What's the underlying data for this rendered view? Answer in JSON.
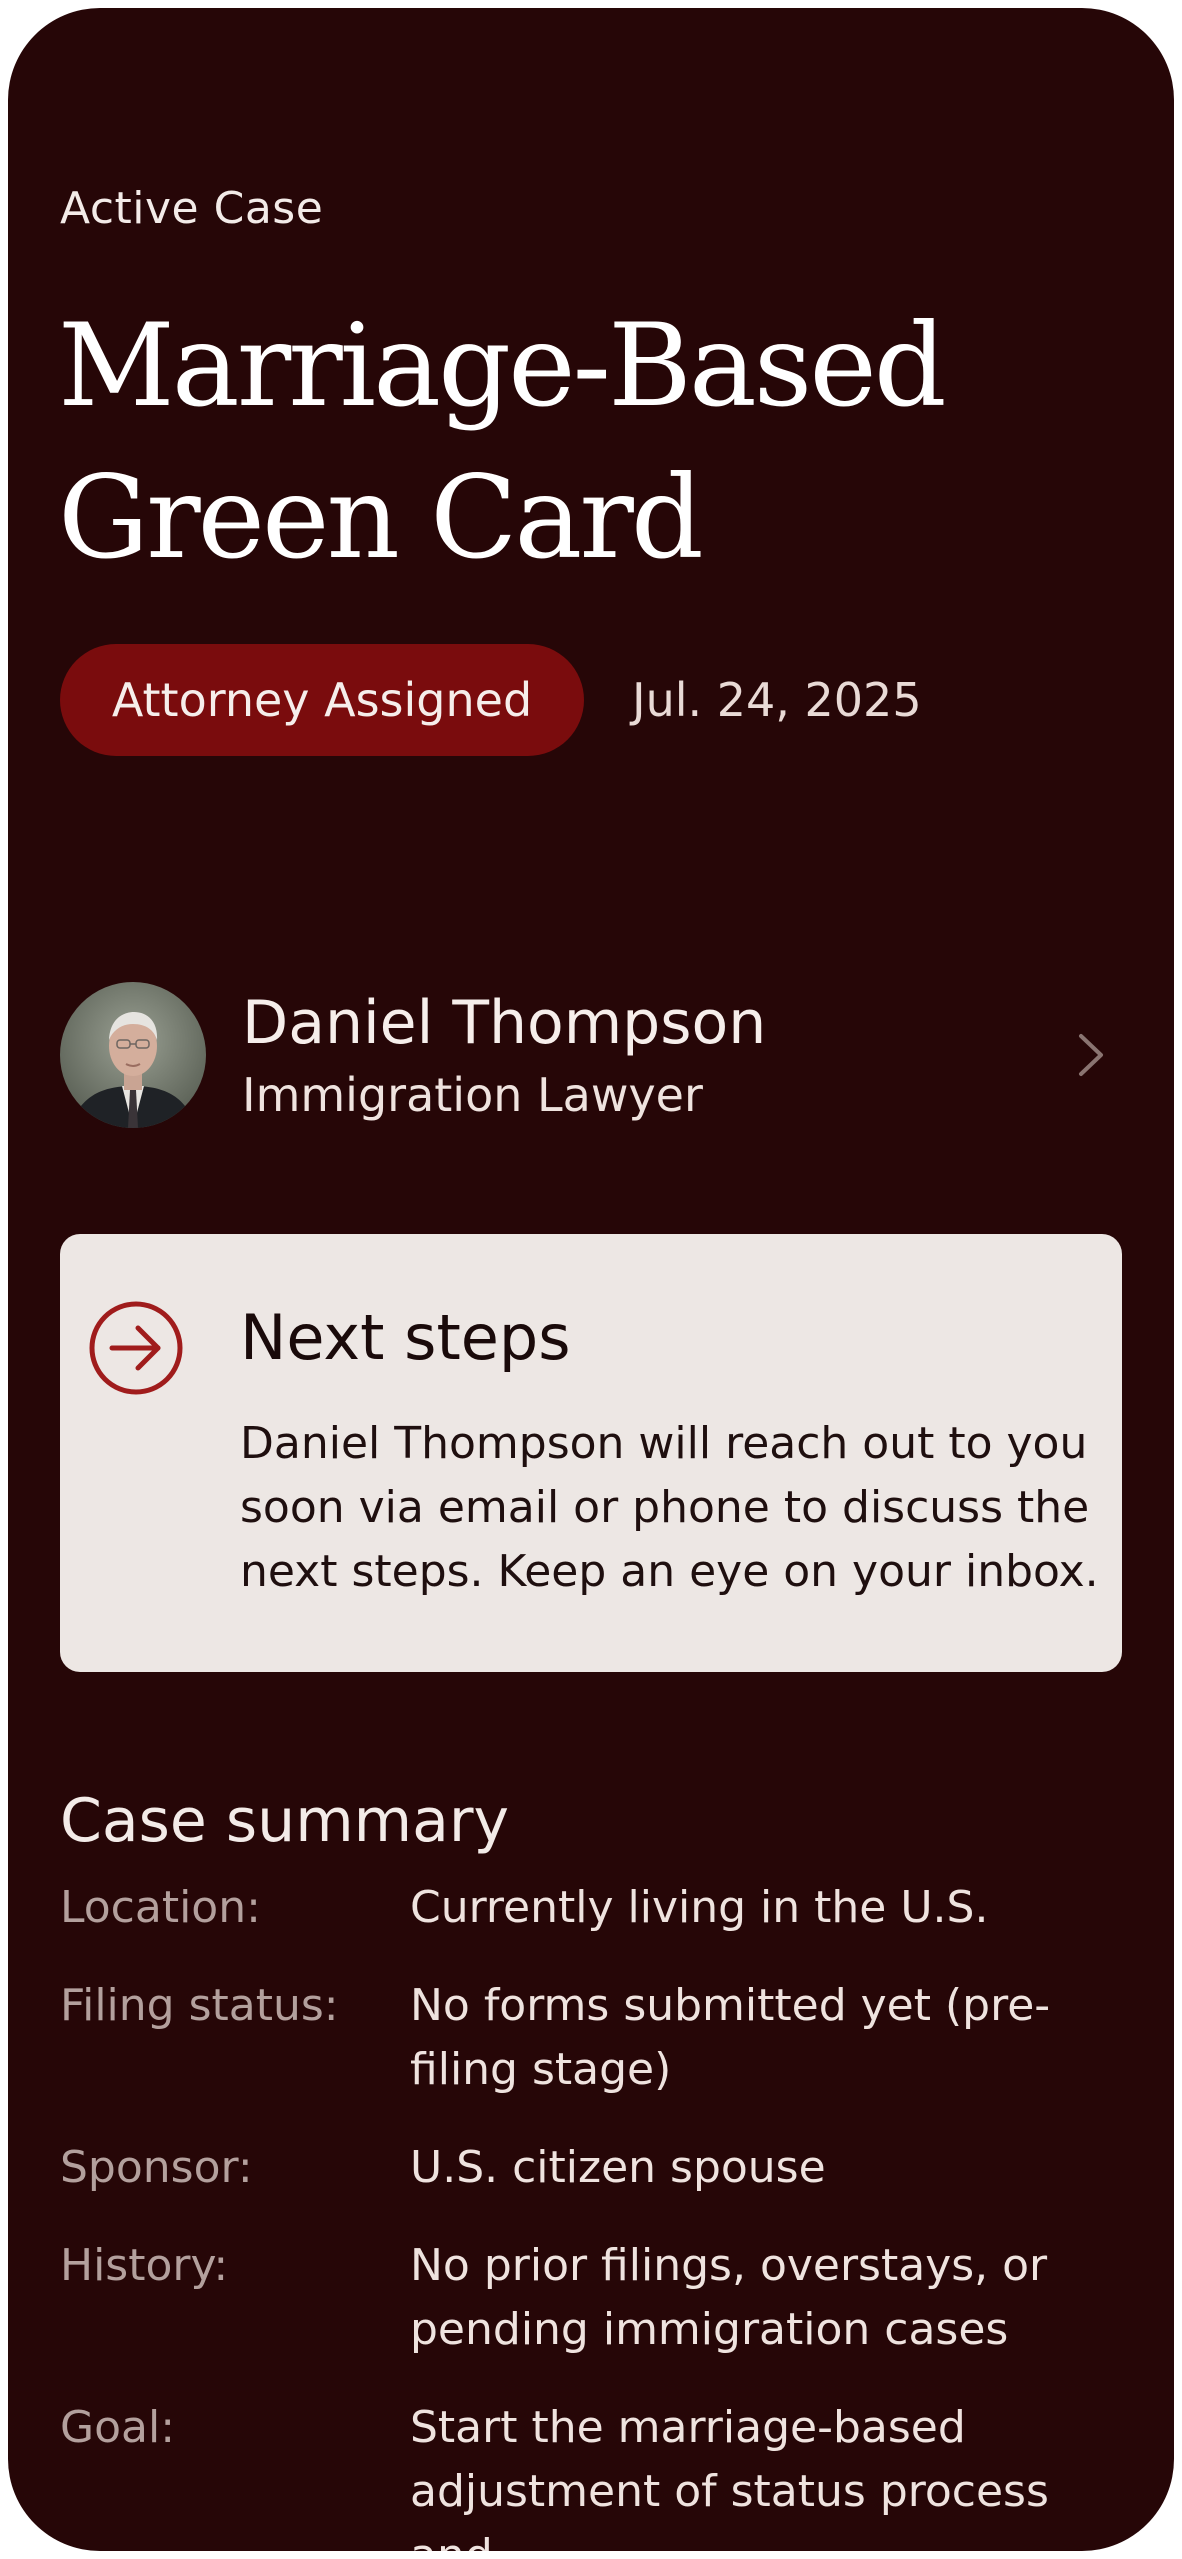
{
  "header": {
    "eyebrow": "Active Case",
    "title": "Marriage-Based Green Card"
  },
  "status": {
    "badge": "Attorney Assigned",
    "date": "Jul. 24, 2025",
    "badge_color": "#7a0c0d"
  },
  "lawyer": {
    "name": "Daniel Thompson",
    "role": "Immigration Lawyer",
    "avatar_icon": "avatar-photo",
    "chevron_icon": "chevron-right-icon"
  },
  "next_steps": {
    "icon": "arrow-right-circle-icon",
    "title": "Next steps",
    "body": "Daniel Thompson will reach out to you soon via email or phone to discuss the next steps. Keep an eye on your inbox."
  },
  "summary": {
    "title": "Case summary",
    "items": [
      {
        "label": "Location:",
        "value": "Currently living in the U.S."
      },
      {
        "label": "Filing status:",
        "value": "No forms submitted yet (pre-filing stage)"
      },
      {
        "label": "Sponsor:",
        "value": "U.S. citizen spouse"
      },
      {
        "label": "History:",
        "value": "No prior filings, overstays, or pending immigration cases"
      },
      {
        "label": "Goal:",
        "value": "Start the marriage-based adjustment of status process and"
      }
    ]
  },
  "colors": {
    "background": "#260607",
    "card": "#ede7e4",
    "accent": "#7a0c0d"
  }
}
